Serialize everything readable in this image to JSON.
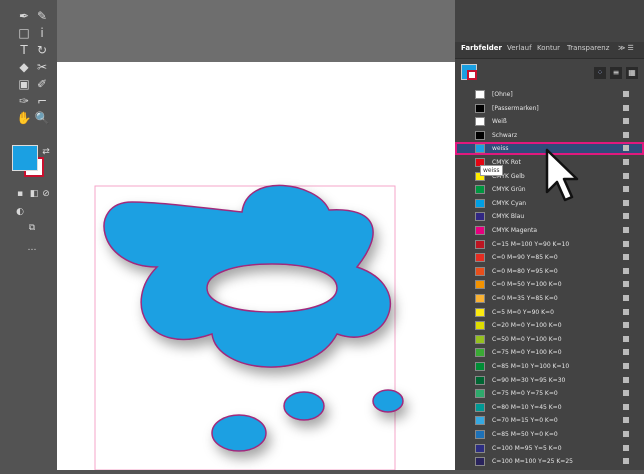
{
  "colors": {
    "accent": "#1ba0e2",
    "selection": "#e0197d",
    "ui_bg": "#535353",
    "panel_bg": "#434343"
  },
  "tools": [
    {
      "name": "pen-icon",
      "glyph": "✒"
    },
    {
      "name": "pencil-icon",
      "glyph": "✎"
    },
    {
      "name": "rectangle-icon",
      "glyph": "□"
    },
    {
      "name": "brush-icon",
      "glyph": "ⅰ"
    },
    {
      "name": "type-icon",
      "glyph": "T"
    },
    {
      "name": "rotate-icon",
      "glyph": "↻"
    },
    {
      "name": "eraser-icon",
      "glyph": "◆"
    },
    {
      "name": "scissors-icon",
      "glyph": "✂"
    },
    {
      "name": "gradient-icon",
      "glyph": "▣"
    },
    {
      "name": "eyedropper-icon",
      "glyph": "✐"
    },
    {
      "name": "blend-icon",
      "glyph": "✑"
    },
    {
      "name": "direct-select-icon",
      "glyph": "⌐"
    },
    {
      "name": "hand-icon",
      "glyph": "✋"
    },
    {
      "name": "zoom-icon",
      "glyph": "🔍"
    }
  ],
  "panel": {
    "tabs": [
      "Farbfelder",
      "Verlauf",
      "Kontur",
      "Transparenz"
    ],
    "tooltip": "weiss",
    "swatches": [
      {
        "name": "[Ohne]",
        "color": "#ffffff"
      },
      {
        "name": "[Passermarken]",
        "color": "#000000"
      },
      {
        "name": "Weiß",
        "color": "#ffffff"
      },
      {
        "name": "Schwarz",
        "color": "#000000"
      },
      {
        "name": "weiss",
        "color": "#1ba0e2",
        "selected": true
      },
      {
        "name": "CMYK Rot",
        "color": "#e30613"
      },
      {
        "name": "CMYK Gelb",
        "color": "#ffed00"
      },
      {
        "name": "CMYK Grün",
        "color": "#009640"
      },
      {
        "name": "CMYK Cyan",
        "color": "#009fe3"
      },
      {
        "name": "CMYK Blau",
        "color": "#312783"
      },
      {
        "name": "CMYK Magenta",
        "color": "#e6007e"
      },
      {
        "name": "C=15 M=100 Y=90 K=10",
        "color": "#be1622"
      },
      {
        "name": "C=0 M=90 Y=85 K=0",
        "color": "#e52d22"
      },
      {
        "name": "C=0 M=80 Y=95 K=0",
        "color": "#e84e1b"
      },
      {
        "name": "C=0 M=50 Y=100 K=0",
        "color": "#f39200"
      },
      {
        "name": "C=0 M=35 Y=85 K=0",
        "color": "#f9b233"
      },
      {
        "name": "C=5 M=0 Y=90 K=0",
        "color": "#fcea10"
      },
      {
        "name": "C=20 M=0 Y=100 K=0",
        "color": "#dedc00"
      },
      {
        "name": "C=50 M=0 Y=100 K=0",
        "color": "#95c11f"
      },
      {
        "name": "C=75 M=0 Y=100 K=0",
        "color": "#3aaa35"
      },
      {
        "name": "C=85 M=10 Y=100 K=10",
        "color": "#008d36"
      },
      {
        "name": "C=90 M=30 Y=95 K=30",
        "color": "#006633"
      },
      {
        "name": "C=75 M=0 Y=75 K=0",
        "color": "#2eaa6c"
      },
      {
        "name": "C=80 M=10 Y=45 K=0",
        "color": "#009994"
      },
      {
        "name": "C=70 M=15 Y=0 K=0",
        "color": "#36a9e1"
      },
      {
        "name": "C=85 M=50 Y=0 K=0",
        "color": "#1d71b8"
      },
      {
        "name": "C=100 M=95 Y=5 K=0",
        "color": "#2d2e83"
      },
      {
        "name": "C=100 M=100 Y=25 K=25",
        "color": "#29235c"
      }
    ]
  }
}
